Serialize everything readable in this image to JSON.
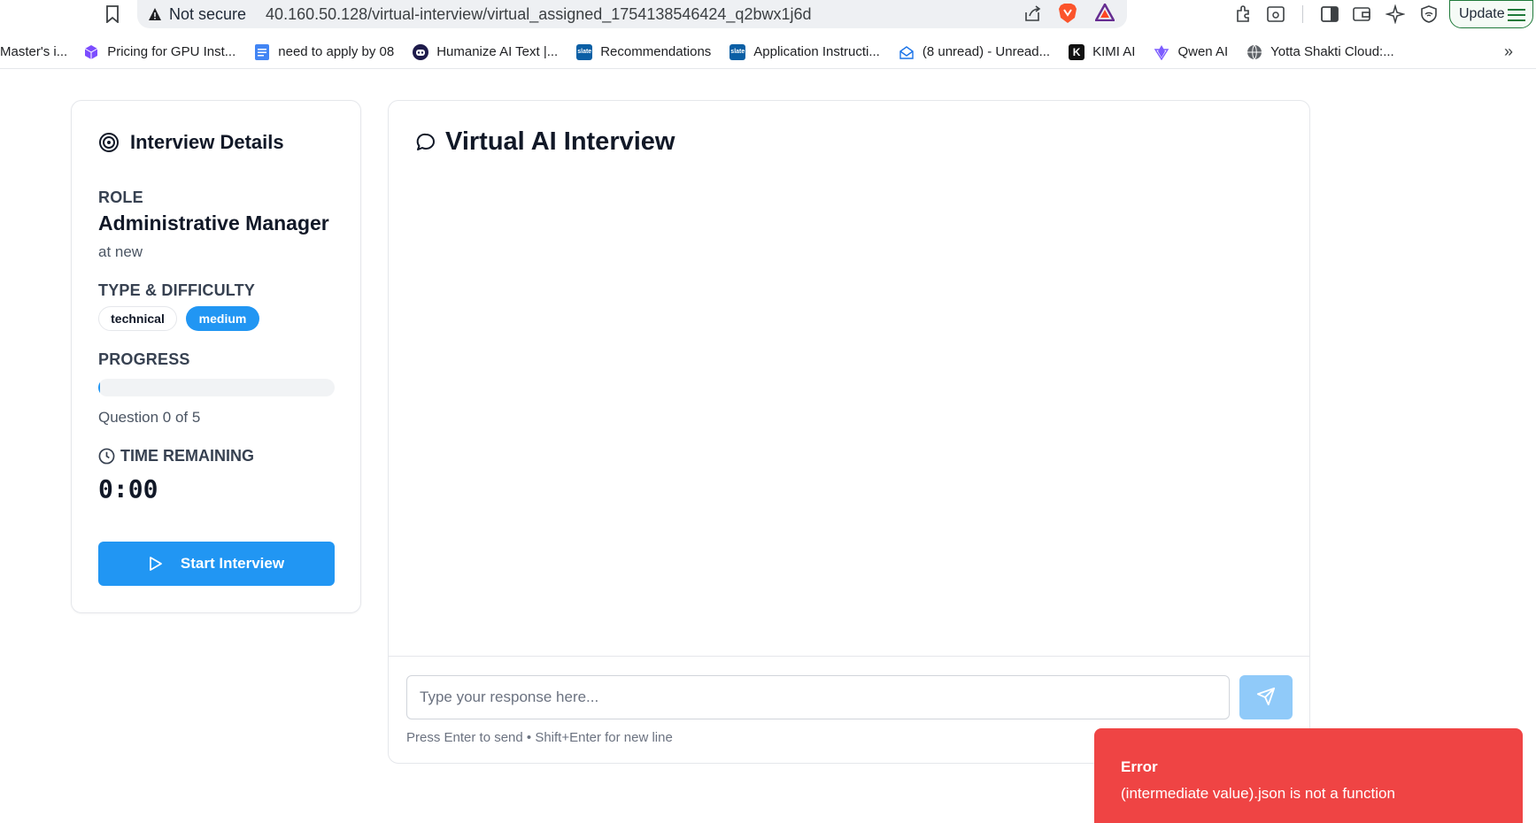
{
  "browser": {
    "security_label": "Not secure",
    "url": "40.160.50.128/virtual-interview/virtual_assigned_1754138546424_q2bwx1j6d",
    "update_label": "Update",
    "bookmarks": [
      {
        "label": "Master's i...",
        "icon": "page-icon",
        "color": "#ffffff"
      },
      {
        "label": "Pricing for GPU Inst...",
        "icon": "cube-icon",
        "color": "#7c4dff"
      },
      {
        "label": "need to apply by 08",
        "icon": "docs-icon",
        "color": "#4285f4"
      },
      {
        "label": "Humanize AI Text |...",
        "icon": "bot-icon",
        "color": "#1e1b4b"
      },
      {
        "label": "Recommendations",
        "icon": "slate-icon",
        "color": "#0b5fa5",
        "glyph": "slate"
      },
      {
        "label": "Application Instructi...",
        "icon": "slate-icon",
        "color": "#0b5fa5",
        "glyph": "slate"
      },
      {
        "label": "(8 unread) - Unread...",
        "icon": "mail-icon",
        "color": "#ffffff"
      },
      {
        "label": "KIMI AI",
        "icon": "kimi-icon",
        "color": "#111111",
        "glyph": "K"
      },
      {
        "label": "Qwen AI",
        "icon": "qwen-icon",
        "color": "#ffffff"
      },
      {
        "label": "Yotta Shakti Cloud:...",
        "icon": "globe-icon",
        "color": "#ffffff"
      }
    ]
  },
  "sidebar": {
    "title": "Interview Details",
    "role_label": "ROLE",
    "role_value": "Administrative Manager",
    "role_company": "at new",
    "type_label": "TYPE & DIFFICULTY",
    "type_badge": "technical",
    "difficulty_badge": "medium",
    "progress_label": "PROGRESS",
    "progress_fraction": 0,
    "progress_text": "Question 0 of 5",
    "time_label": "TIME REMAINING",
    "time_value": "0:00",
    "start_button": "Start Interview"
  },
  "main": {
    "title": "Virtual AI Interview",
    "input_placeholder": "Type your response here...",
    "hint": "Press Enter to send • Shift+Enter for new line"
  },
  "toast": {
    "title": "Error",
    "message": "(intermediate value).json is not a function"
  },
  "colors": {
    "accent": "#2196f3",
    "accent_light": "#90caf9",
    "error": "#ef4444"
  }
}
